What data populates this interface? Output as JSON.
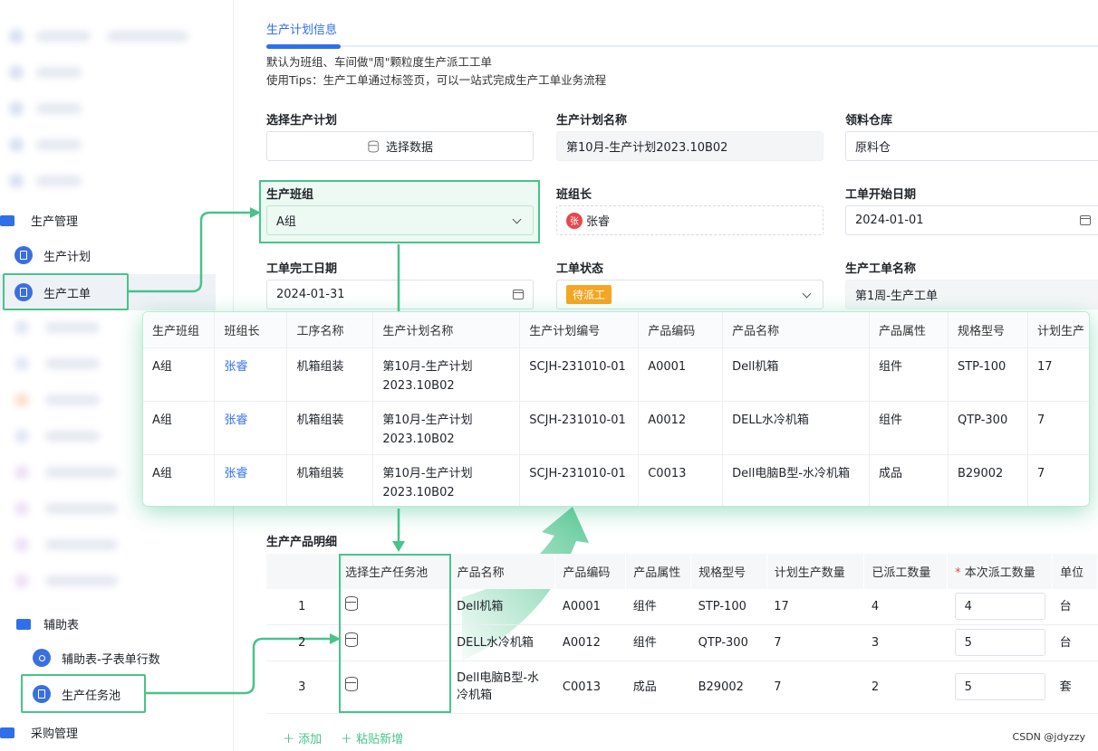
{
  "sidebar": {
    "group_production": "生产管理",
    "item_plan": "生产计划",
    "item_workorder": "生产工单",
    "group_aux": "辅助表",
    "item_aux_rows": "辅助表-子表单行数",
    "item_taskpool": "生产任务池",
    "group_purchase": "采购管理"
  },
  "tab": {
    "label": "生产计划信息"
  },
  "notes": [
    "默认为班组、车间做\"周\"颗粒度生产派工工单",
    "使用Tips：生产工单通过标签页，可以一站式完成生产工单业务流程"
  ],
  "form": {
    "select_plan_label": "选择生产计划",
    "select_plan_button": "选择数据",
    "plan_name_label": "生产计划名称",
    "plan_name_value": "第10月-生产计划2023.10B02",
    "warehouse_label": "领料仓库",
    "warehouse_value": "原料仓",
    "team_label": "生产班组",
    "team_value": "A组",
    "leader_label": "班组长",
    "leader_avatar": "张",
    "leader_value": "张睿",
    "start_label": "工单开始日期",
    "start_value": "2024-01-01",
    "end_label": "工单完工日期",
    "end_value": "2024-01-31",
    "status_label": "工单状态",
    "status_value": "待派工",
    "wo_name_label": "生产工单名称",
    "wo_name_value": "第1周-生产工单"
  },
  "popup": {
    "headers": [
      "生产班组",
      "班组长",
      "工序名称",
      "生产计划名称",
      "生产计划编号",
      "产品编码",
      "产品名称",
      "产品属性",
      "规格型号",
      "计划生产"
    ],
    "rows": [
      [
        "A组",
        "张睿",
        "机箱组装",
        "第10月-生产计划\n2023.10B02",
        "SCJH-231010-01",
        "A0001",
        "Dell机箱",
        "组件",
        "STP-100",
        "17"
      ],
      [
        "A组",
        "张睿",
        "机箱组装",
        "第10月-生产计划\n2023.10B02",
        "SCJH-231010-01",
        "A0012",
        "DELL水冷机箱",
        "组件",
        "QTP-300",
        "7"
      ],
      [
        "A组",
        "张睿",
        "机箱组装",
        "第10月-生产计划\n2023.10B02",
        "SCJH-231010-01",
        "C0013",
        "Dell电脑B型-水冷机箱",
        "成品",
        "B29002",
        "7"
      ]
    ]
  },
  "detail": {
    "title": "生产产品明细",
    "headers": [
      "",
      "选择生产任务池",
      "产品名称",
      "产品编码",
      "产品属性",
      "规格型号",
      "计划生产数量",
      "已派工数量",
      "本次派工数量",
      "单位"
    ],
    "required_mark": "*",
    "rows": [
      [
        "1",
        "",
        "Dell机箱",
        "A0001",
        "组件",
        "STP-100",
        "17",
        "4",
        "4",
        "台"
      ],
      [
        "2",
        "",
        "DELL水冷机箱",
        "A0012",
        "组件",
        "QTP-300",
        "7",
        "3",
        "5",
        "台"
      ],
      [
        "3",
        "",
        "Dell电脑B型-水冷机箱",
        "C0013",
        "成品",
        "B29002",
        "7",
        "2",
        "5",
        "套"
      ]
    ],
    "add_label": "添加",
    "paste_label": "粘贴新增"
  },
  "watermark": "CSDN @jdyzzy",
  "colors": {
    "accent": "#2f6feb",
    "highlight": "#49c28b",
    "status": "#f5a623"
  }
}
